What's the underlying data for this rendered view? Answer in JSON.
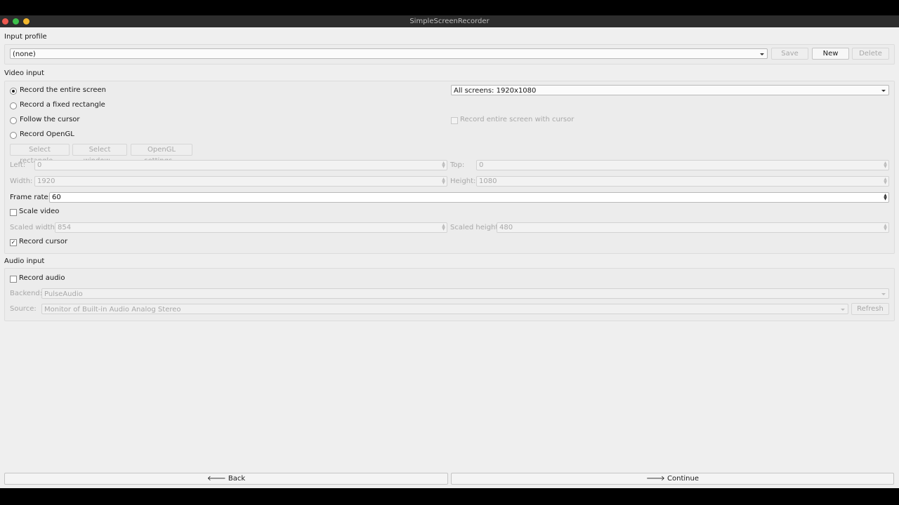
{
  "window": {
    "title": "SimpleScreenRecorder"
  },
  "input_profile": {
    "section_label": "Input profile",
    "selected": "(none)",
    "save_label": "Save",
    "new_label": "New",
    "delete_label": "Delete"
  },
  "video_input": {
    "section_label": "Video input",
    "radios": {
      "entire_screen": "Record the entire screen",
      "fixed_rect": "Record a fixed rectangle",
      "follow_cursor": "Follow the cursor",
      "opengl": "Record OpenGL"
    },
    "screen_select": "All screens: 1920x1080",
    "entire_screen_cursor_label": "Record entire screen with cursor",
    "select_rectangle_label": "Select rectangle...",
    "select_window_label": "Select window...",
    "opengl_settings_label": "OpenGL settings...",
    "left_label": "Left:",
    "left_value": "0",
    "top_label": "Top:",
    "top_value": "0",
    "width_label": "Width:",
    "width_value": "1920",
    "height_label": "Height:",
    "height_value": "1080",
    "frame_rate_label": "Frame rate:",
    "frame_rate_value": "60",
    "scale_video_label": "Scale video",
    "scaled_width_label": "Scaled width:",
    "scaled_width_value": "854",
    "scaled_height_label": "Scaled height:",
    "scaled_height_value": "480",
    "record_cursor_label": "Record cursor",
    "checkmark": "✓"
  },
  "audio_input": {
    "section_label": "Audio input",
    "record_audio_label": "Record audio",
    "backend_label": "Backend:",
    "backend_value": "PulseAudio",
    "source_label": "Source:",
    "source_value": "Monitor of Built-in Audio Analog Stereo",
    "refresh_label": "Refresh"
  },
  "nav": {
    "back_label": "🡐 Back",
    "continue_label": "🡒 Continue"
  }
}
